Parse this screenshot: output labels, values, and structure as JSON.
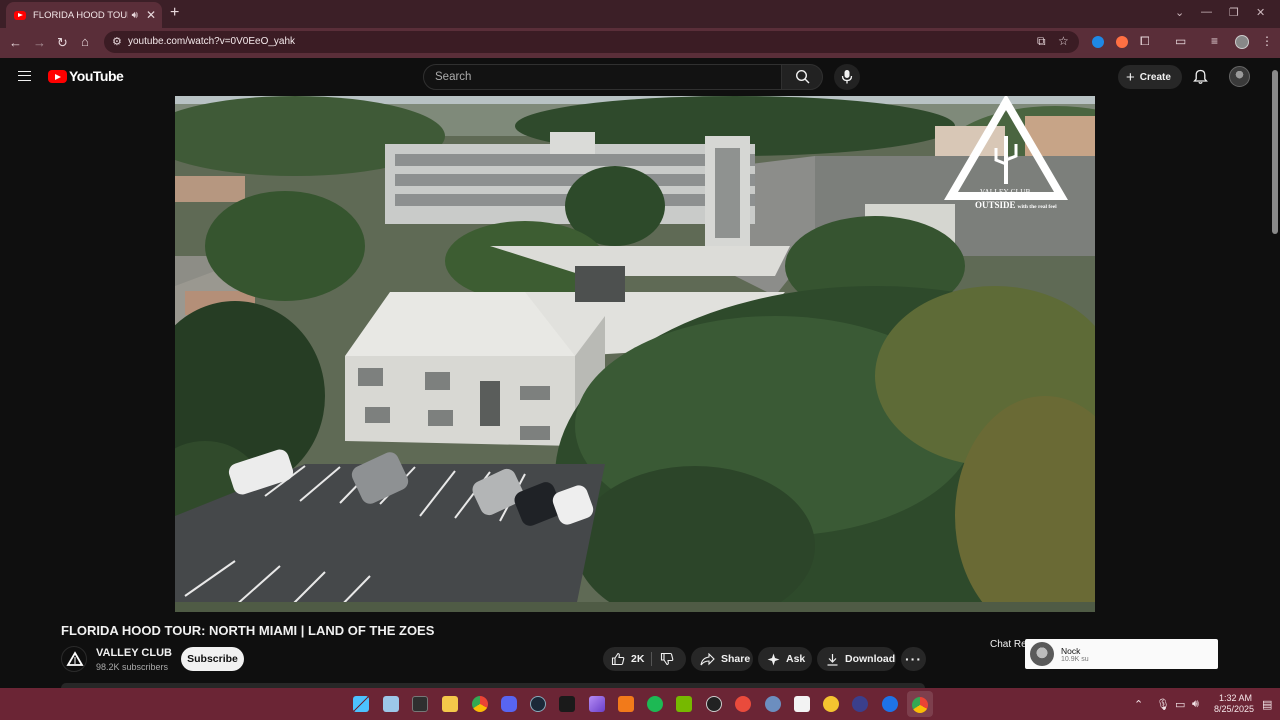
{
  "browser": {
    "tab_title": "FLORIDA HOOD TOUR: NORTH MIAMI | LAND OF THE ZOES",
    "url": "youtube.com/watch?v=0V0EeO_yahk"
  },
  "youtube": {
    "logo_text": "YouTube",
    "search_placeholder": "Search",
    "create_label": "Create"
  },
  "video": {
    "title": "FLORIDA HOOD TOUR: NORTH MIAMI | LAND OF THE ZOES",
    "watermark_brand": "VALLEY CLUB",
    "watermark_tagline_strong": "OUTSIDE",
    "watermark_tagline_rest": "with the real feel",
    "channel": {
      "name": "VALLEY CLUB",
      "subscribers": "98.2K subscribers",
      "subscribe_label": "Subscribe"
    },
    "actions": {
      "likes": "2K",
      "share": "Share",
      "ask": "Ask",
      "download": "Download",
      "more": "···"
    }
  },
  "chat": {
    "label": "Chat Rep",
    "notification_name": "Nock",
    "notification_sub": "10.9K su"
  },
  "taskbar": {
    "time": "1:32 AM",
    "date": "8/25/2025"
  },
  "colors": {
    "tab_bg": "#3c1f27",
    "toolbar_bg": "#5a2e39",
    "yt_bg": "#0f0f0f",
    "yt_red": "#ff0000",
    "taskbar_bg": "#6b2535"
  }
}
